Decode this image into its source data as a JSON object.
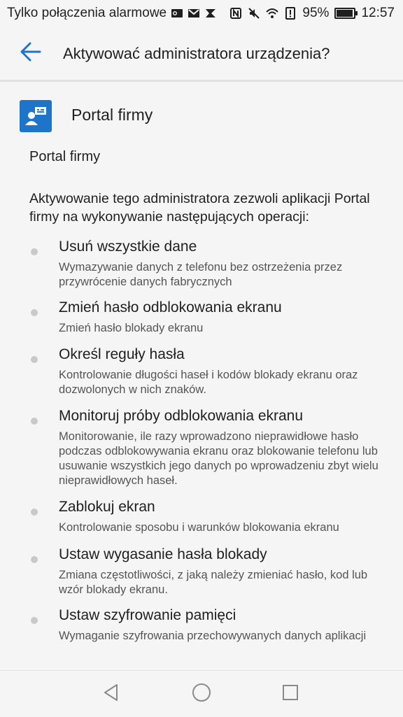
{
  "status_bar": {
    "carrier_text": "Tylko połączenia alarmowe",
    "battery_percent": "95%",
    "battery_level": 0.95,
    "time": "12:57",
    "icons_left": [
      "outlook-icon",
      "gmail-icon",
      "tasks-icon"
    ],
    "icons_right": [
      "nfc-icon",
      "mute-icon",
      "wifi-icon",
      "alert-icon",
      "battery-icon"
    ]
  },
  "app_bar": {
    "title": "Aktywować administratora urządzenia?"
  },
  "app": {
    "name": "Portal firmy",
    "subtitle": "Portal firmy",
    "icon_color": "#1e74c9"
  },
  "intro": "Aktywowanie tego administratora zezwoli aplikacji Portal firmy na wykonywanie następujących operacji:",
  "permissions": [
    {
      "title": "Usuń wszystkie dane",
      "description": "Wymazywanie danych z telefonu bez ostrzeżenia przez przywrócenie danych fabrycznych"
    },
    {
      "title": "Zmień hasło odblokowania ekranu",
      "description": "Zmień hasło blokady ekranu"
    },
    {
      "title": "Określ reguły hasła",
      "description": "Kontrolowanie długości haseł i kodów blokady ekranu oraz dozwolonych w nich znaków."
    },
    {
      "title": "Monitoruj próby odblokowania ekranu",
      "description": "Monitorowanie, ile razy wprowadzono nieprawidłowe hasło podczas odblokowywania ekranu oraz blokowanie telefonu lub usuwanie wszystkich jego danych po wprowadzeniu zbyt wielu nieprawidłowych haseł."
    },
    {
      "title": "Zablokuj ekran",
      "description": "Kontrolowanie sposobu i warunków blokowania ekranu"
    },
    {
      "title": "Ustaw wygasanie hasła blokady",
      "description": "Zmiana częstotliwości, z jaką należy zmieniać hasło, kod lub wzór blokady ekranu."
    },
    {
      "title": "Ustaw szyfrowanie pamięci",
      "description": "Wymaganie szyfrowania przechowywanych danych aplikacji"
    }
  ],
  "nav_bar": {
    "buttons": [
      "back-triangle-icon",
      "home-circle-icon",
      "recents-square-icon"
    ]
  },
  "colors": {
    "accent": "#1e74c9",
    "background": "#f5f5f5",
    "dot": "#c9c9c9"
  }
}
